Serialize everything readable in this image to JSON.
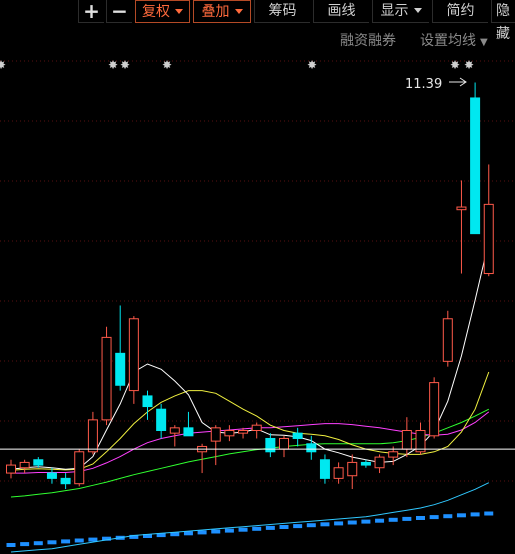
{
  "toolbar": {
    "plus_label": "+",
    "minus_label": "−",
    "fuquan_label": "复权",
    "diejia_label": "叠加",
    "chouma_label": "筹码",
    "huaxian_label": "画线",
    "xianshi_label": "显示",
    "jianyue_label": "简约",
    "yincang_label": "隐藏"
  },
  "subbar": {
    "margin_label": "融资融券",
    "ma_settings_label": "设置均线"
  },
  "annotations": {
    "max_price_label": "11.39"
  },
  "colors": {
    "up": "#ff5a4a",
    "down": "#00e8f0",
    "ma5": "#ffffff",
    "ma10": "#f0f040",
    "ma20": "#ff40ff",
    "ma60": "#30ff30",
    "grid": "#5a1010",
    "volume": "#1e90ff"
  },
  "chart_data": {
    "type": "candlestick",
    "price_range": [
      3.6,
      11.4
    ],
    "reference_line": 4.5,
    "candles": [
      {
        "o": 4.05,
        "h": 4.3,
        "l": 3.95,
        "c": 4.2
      },
      {
        "o": 4.15,
        "h": 4.3,
        "l": 4.05,
        "c": 4.25
      },
      {
        "o": 4.3,
        "h": 4.35,
        "l": 4.15,
        "c": 4.2
      },
      {
        "o": 4.05,
        "h": 4.15,
        "l": 3.85,
        "c": 3.95
      },
      {
        "o": 3.95,
        "h": 4.05,
        "l": 3.75,
        "c": 3.85
      },
      {
        "o": 3.85,
        "h": 4.5,
        "l": 3.8,
        "c": 4.45
      },
      {
        "o": 4.45,
        "h": 5.2,
        "l": 4.4,
        "c": 5.05
      },
      {
        "o": 5.05,
        "h": 6.8,
        "l": 4.95,
        "c": 6.6
      },
      {
        "o": 6.3,
        "h": 7.2,
        "l": 5.6,
        "c": 5.7
      },
      {
        "o": 5.6,
        "h": 7.0,
        "l": 5.35,
        "c": 6.95
      },
      {
        "o": 5.5,
        "h": 5.6,
        "l": 5.05,
        "c": 5.3
      },
      {
        "o": 5.25,
        "h": 5.35,
        "l": 4.7,
        "c": 4.85
      },
      {
        "o": 4.8,
        "h": 4.95,
        "l": 4.55,
        "c": 4.9
      },
      {
        "o": 4.9,
        "h": 5.2,
        "l": 4.75,
        "c": 4.75
      },
      {
        "o": 4.45,
        "h": 4.6,
        "l": 4.05,
        "c": 4.55
      },
      {
        "o": 4.65,
        "h": 4.95,
        "l": 4.2,
        "c": 4.9
      },
      {
        "o": 4.75,
        "h": 4.95,
        "l": 4.65,
        "c": 4.85
      },
      {
        "o": 4.8,
        "h": 4.9,
        "l": 4.7,
        "c": 4.85
      },
      {
        "o": 4.85,
        "h": 5.0,
        "l": 4.7,
        "c": 4.95
      },
      {
        "o": 4.7,
        "h": 4.8,
        "l": 4.35,
        "c": 4.45
      },
      {
        "o": 4.5,
        "h": 4.75,
        "l": 4.35,
        "c": 4.7
      },
      {
        "o": 4.8,
        "h": 4.9,
        "l": 4.55,
        "c": 4.7
      },
      {
        "o": 4.6,
        "h": 4.75,
        "l": 4.3,
        "c": 4.45
      },
      {
        "o": 4.3,
        "h": 4.4,
        "l": 3.85,
        "c": 3.95
      },
      {
        "o": 3.95,
        "h": 4.25,
        "l": 3.85,
        "c": 4.15
      },
      {
        "o": 4.0,
        "h": 4.4,
        "l": 3.75,
        "c": 4.25
      },
      {
        "o": 4.25,
        "h": 4.3,
        "l": 4.15,
        "c": 4.2
      },
      {
        "o": 4.15,
        "h": 4.4,
        "l": 4.05,
        "c": 4.35
      },
      {
        "o": 4.35,
        "h": 4.55,
        "l": 4.2,
        "c": 4.45
      },
      {
        "o": 4.5,
        "h": 5.1,
        "l": 4.35,
        "c": 4.85
      },
      {
        "o": 4.45,
        "h": 5.0,
        "l": 4.4,
        "c": 4.85
      },
      {
        "o": 4.75,
        "h": 5.85,
        "l": 4.7,
        "c": 5.75
      },
      {
        "o": 6.15,
        "h": 7.1,
        "l": 6.05,
        "c": 6.95
      },
      {
        "o": 9.0,
        "h": 9.55,
        "l": 7.8,
        "c": 9.05
      },
      {
        "o": 11.1,
        "h": 11.39,
        "l": 8.55,
        "c": 8.55
      },
      {
        "o": 7.8,
        "h": 9.85,
        "l": 7.75,
        "c": 9.1
      }
    ],
    "ma5": [
      4.12,
      4.15,
      4.17,
      4.15,
      4.12,
      4.14,
      4.36,
      4.86,
      5.35,
      5.95,
      6.1,
      6.0,
      5.78,
      5.52,
      5.0,
      4.82,
      4.8,
      4.82,
      4.88,
      4.77,
      4.76,
      4.73,
      4.66,
      4.5,
      4.43,
      4.35,
      4.3,
      4.25,
      4.27,
      4.4,
      4.56,
      4.84,
      5.4,
      6.25,
      7.3,
      8.4
    ],
    "ma10": [
      4.1,
      4.12,
      4.13,
      4.12,
      4.11,
      4.12,
      4.22,
      4.45,
      4.7,
      4.98,
      5.2,
      5.38,
      5.5,
      5.6,
      5.6,
      5.55,
      5.4,
      5.25,
      5.12,
      4.95,
      4.85,
      4.8,
      4.78,
      4.75,
      4.68,
      4.58,
      4.5,
      4.45,
      4.42,
      4.4,
      4.4,
      4.45,
      4.55,
      4.82,
      5.25,
      5.95
    ],
    "ma20": [
      4.05,
      4.05,
      4.06,
      4.06,
      4.06,
      4.08,
      4.14,
      4.24,
      4.36,
      4.5,
      4.62,
      4.7,
      4.75,
      4.8,
      4.82,
      4.84,
      4.86,
      4.88,
      4.9,
      4.9,
      4.92,
      4.94,
      4.96,
      4.98,
      4.98,
      4.96,
      4.93,
      4.9,
      4.86,
      4.82,
      4.78,
      4.76,
      4.78,
      4.86,
      5.0,
      5.2
    ],
    "ma60": [
      3.6,
      3.62,
      3.65,
      3.68,
      3.72,
      3.76,
      3.82,
      3.88,
      3.95,
      4.02,
      4.08,
      4.14,
      4.2,
      4.26,
      4.31,
      4.36,
      4.41,
      4.45,
      4.49,
      4.52,
      4.55,
      4.57,
      4.59,
      4.6,
      4.6,
      4.6,
      4.6,
      4.6,
      4.62,
      4.66,
      4.72,
      4.8,
      4.9,
      5.0,
      5.12,
      5.25
    ],
    "volume_ma": [
      3.55,
      3.56,
      3.57,
      3.58,
      3.6,
      3.62,
      3.64,
      3.66,
      3.68,
      3.7,
      3.71,
      3.72,
      3.73,
      3.74,
      3.75,
      3.76,
      3.77,
      3.78,
      3.79,
      3.8,
      3.81,
      3.82,
      3.83,
      3.84,
      3.85,
      3.86,
      3.87,
      3.89,
      3.91,
      3.93,
      3.95,
      3.98,
      4.02,
      4.07,
      4.12,
      4.18
    ]
  }
}
